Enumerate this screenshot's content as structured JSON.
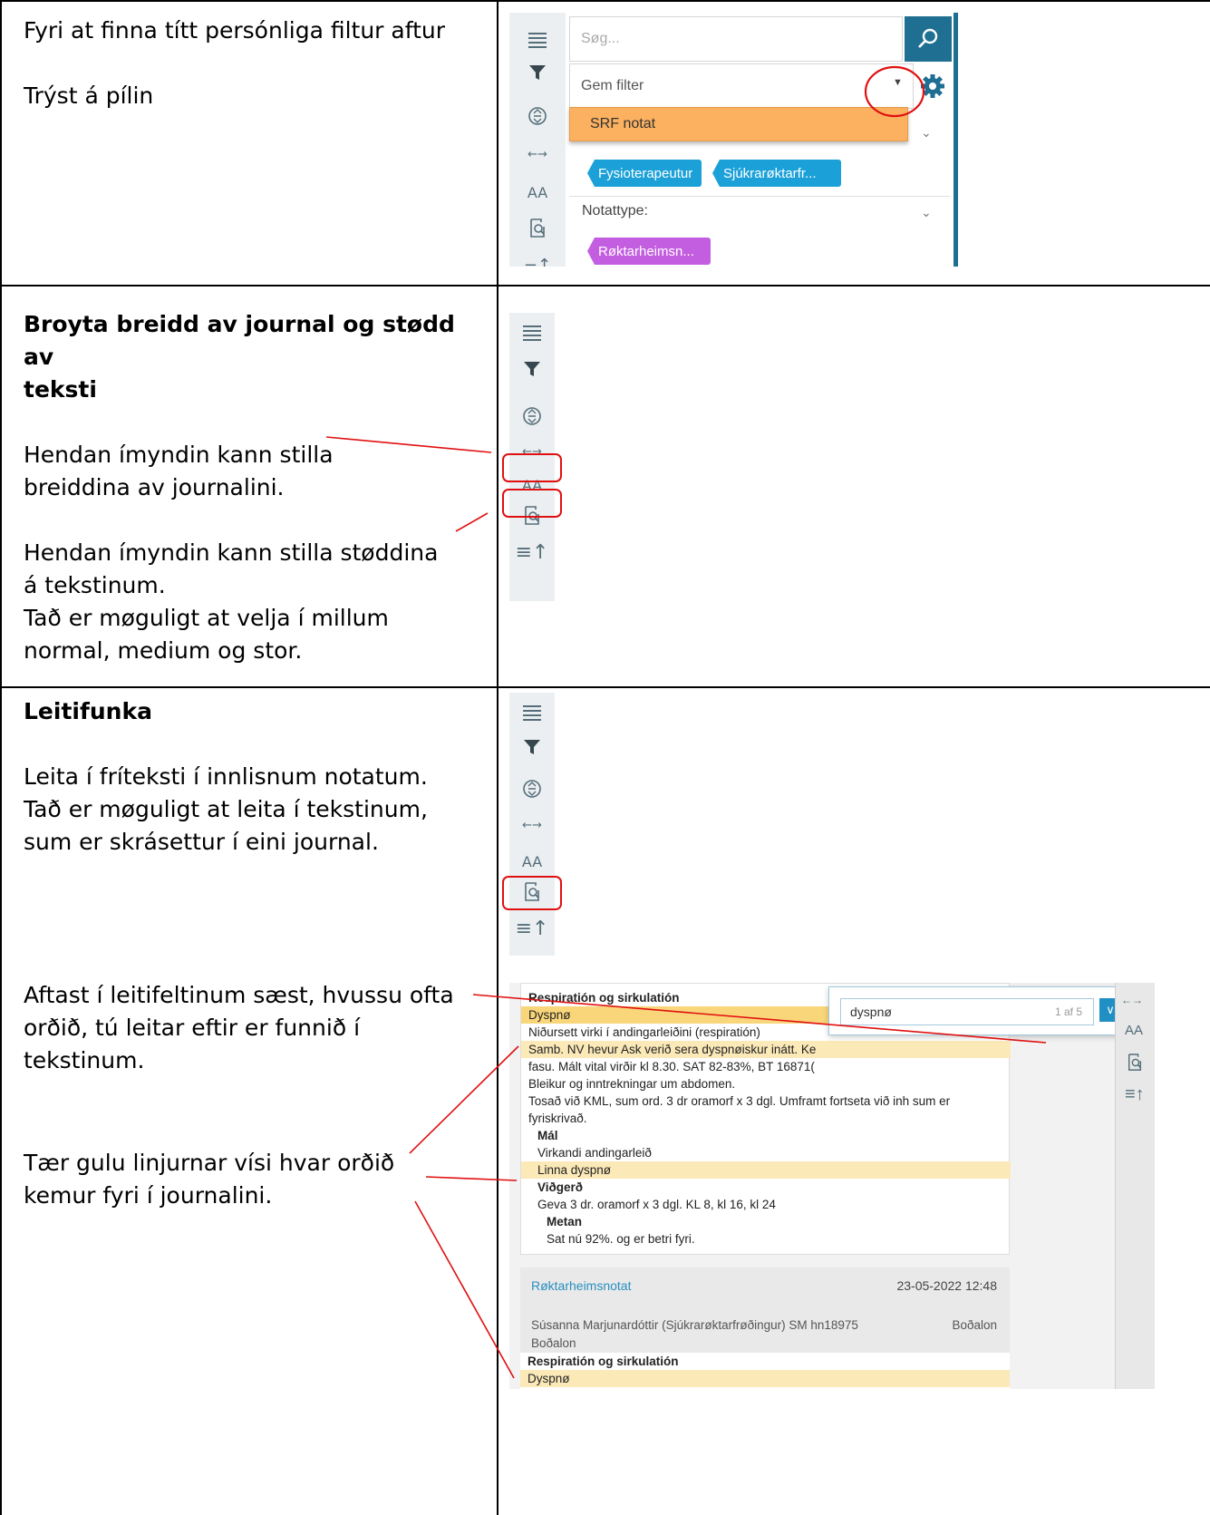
{
  "rows": [
    {
      "lines": [
        "Fyri at finna títt persónliga filtur aftur",
        "",
        "Trýst á pílin"
      ]
    },
    {
      "title_lines": [
        "Broyta breidd av journal og stødd av",
        "teksti"
      ],
      "lines": [
        "",
        "Hendan ímyndin kann stilla",
        "breiddina av journalini.",
        "",
        "Hendan ímyndin kann stilla støddina",
        "á tekstinum.",
        "Tað er møguligt at velja í millum",
        "normal, medium og stor."
      ]
    },
    {
      "title_lines": [
        "Leitifunka"
      ],
      "lines": [
        "",
        "Leita í fríteksti í innlisnum notatum.",
        "Tað er møguligt at leita í tekstinum,",
        "sum er skrásettur í eini journal."
      ],
      "lines2": [
        "Aftast í leitifeltinum sæst, hvussu ofta",
        "orðið, tú leitar eftir er funnið í",
        "tekstinum."
      ],
      "lines3": [
        "Tær gulu linjurnar vísi hvar orðið",
        "kemur fyri í journalini."
      ]
    }
  ],
  "filter_panel": {
    "search_placeholder": "Søg...",
    "select_value": "Gem filter",
    "dropdown_option": "SRF notat",
    "chips": [
      "Fysioterapeutur",
      "Sjúkrarøktarfr..."
    ],
    "notattype_label": "Notattype:",
    "chip_purple": "Røktarheimsn..."
  },
  "journal": {
    "lines": [
      {
        "text": "Respiratión og sirkulatión",
        "style": "b"
      },
      {
        "text": "Dyspnø",
        "style": "hl-strong"
      },
      {
        "text": "Niðursett virki í andingarleiðini (respiratión)",
        "style": ""
      },
      {
        "text": "Samb. NV hevur Ask verið sera dyspnøiskur inátt. Ke",
        "style": "hl"
      },
      {
        "text": "fasu. Mált vital virðir kl 8.30. SAT 82-83%, BT 16871(",
        "style": ""
      },
      {
        "text": "Bleikur og inntrekningar um abdomen.",
        "style": ""
      },
      {
        "text": "Tosað við KML, sum ord. 3 dr oramorf x 3 dgl. Umframt fortseta við inh sum er",
        "style": ""
      },
      {
        "text": "fyriskrivað.",
        "style": ""
      },
      {
        "text": "Mál",
        "style": "b",
        "indent": 1
      },
      {
        "text": "Virkandi andingarleið",
        "style": "",
        "indent": 1
      },
      {
        "text": "Linna dyspnø",
        "style": "hl",
        "indent": 1
      },
      {
        "text": "Viðgerð",
        "style": "b",
        "indent": 1
      },
      {
        "text": "Geva 3 dr. oramorf x 3 dgl. KL 8, kl 16, kl 24",
        "style": "",
        "indent": 1
      },
      {
        "text": "Metan",
        "style": "b",
        "indent": 2
      },
      {
        "text": "Sat nú 92%. og er betri fyri.",
        "style": "",
        "indent": 2
      }
    ],
    "search_value": "dyspnø",
    "search_count": "1 af 5",
    "note_title": "Røktarheimsnotat",
    "note_date": "23-05-2022 12:48",
    "note_author": "Súsanna Marjunardóttir (Sjúkrarøktarfrøðingur) SM hn18975",
    "note_place1": "Boðalon",
    "note_place2": "Boðalon",
    "bottom_lines": [
      {
        "text": "Respiratión og sirkulatión",
        "style": "b"
      },
      {
        "text": "Dyspnø",
        "style": "hl"
      }
    ]
  },
  "colors": {
    "highlight_circle": "#e01010",
    "annotation_line": "#e01010",
    "search_button": "#1f6f93",
    "gear": "#1f6f93",
    "dropdown_option_bg": "#fbb15f"
  },
  "icons": [
    "menu-icon",
    "filter-icon",
    "expand-collapse-icon",
    "width-arrows-icon",
    "text-size-icon",
    "search-doc-icon",
    "sort-up-icon",
    "magnifier-icon",
    "gear-icon",
    "caret-down-icon",
    "chevron-down-icon",
    "chevron-down-nav-icon",
    "chevron-up-nav-icon"
  ]
}
